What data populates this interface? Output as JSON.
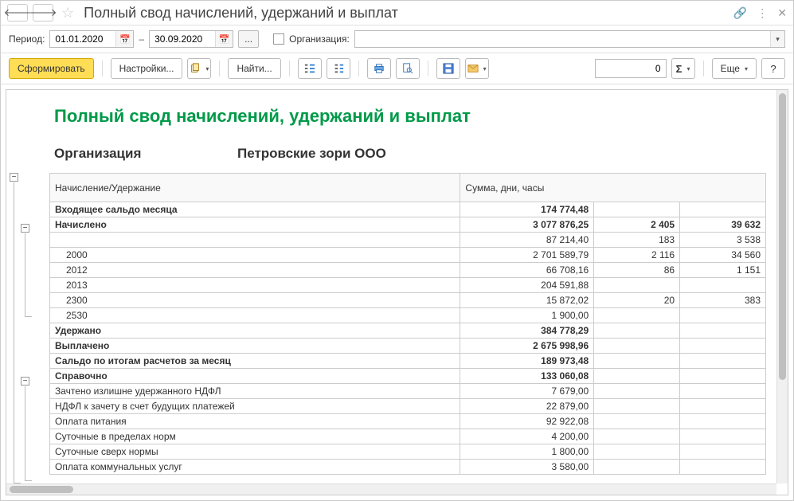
{
  "header": {
    "title": "Полный свод начислений, удержаний и выплат"
  },
  "period": {
    "label": "Период:",
    "from": "01.01.2020",
    "to": "30.09.2020",
    "org_label": "Организация:",
    "org_value": ""
  },
  "toolbar": {
    "generate": "Сформировать",
    "settings": "Настройки...",
    "find": "Найти...",
    "num": "0",
    "more": "Еще"
  },
  "report": {
    "title": "Полный свод начислений, удержаний и выплат",
    "org_label": "Организация",
    "org_value": "Петровские зори ООО",
    "col_name": "Начисление/Удержание",
    "col_sum": "Сумма, дни, часы",
    "rows": [
      {
        "name": "Входящее сальдо месяца",
        "sum": "174 774,48",
        "d": "",
        "h": "",
        "bold": true,
        "indent": 0
      },
      {
        "name": "Начислено",
        "sum": "3 077 876,25",
        "d": "2 405",
        "h": "39 632",
        "bold": true,
        "indent": 0
      },
      {
        "name": "",
        "sum": "87 214,40",
        "d": "183",
        "h": "3 538",
        "bold": false,
        "indent": 1
      },
      {
        "name": "2000",
        "sum": "2 701 589,79",
        "d": "2 116",
        "h": "34 560",
        "bold": false,
        "indent": 1
      },
      {
        "name": "2012",
        "sum": "66 708,16",
        "d": "86",
        "h": "1 151",
        "bold": false,
        "indent": 1
      },
      {
        "name": "2013",
        "sum": "204 591,88",
        "d": "",
        "h": "",
        "bold": false,
        "indent": 1
      },
      {
        "name": "2300",
        "sum": "15 872,02",
        "d": "20",
        "h": "383",
        "bold": false,
        "indent": 1
      },
      {
        "name": "2530",
        "sum": "1 900,00",
        "d": "",
        "h": "",
        "bold": false,
        "indent": 1
      },
      {
        "name": "Удержано",
        "sum": "384 778,29",
        "d": "",
        "h": "",
        "bold": true,
        "indent": 0
      },
      {
        "name": "Выплачено",
        "sum": "2 675 998,96",
        "d": "",
        "h": "",
        "bold": true,
        "indent": 0
      },
      {
        "name": "Сальдо по итогам расчетов за месяц",
        "sum": "189 973,48",
        "d": "",
        "h": "",
        "bold": true,
        "indent": 0
      },
      {
        "name": "Справочно",
        "sum": "133 060,08",
        "d": "",
        "h": "",
        "bold": true,
        "indent": 0
      },
      {
        "name": "Зачтено излишне удержанного НДФЛ",
        "sum": "7 679,00",
        "d": "",
        "h": "",
        "bold": false,
        "indent": 0
      },
      {
        "name": "НДФЛ к зачету в счет будущих платежей",
        "sum": "22 879,00",
        "d": "",
        "h": "",
        "bold": false,
        "indent": 0
      },
      {
        "name": "Оплата питания",
        "sum": "92 922,08",
        "d": "",
        "h": "",
        "bold": false,
        "indent": 0
      },
      {
        "name": "Суточные в пределах норм",
        "sum": "4 200,00",
        "d": "",
        "h": "",
        "bold": false,
        "indent": 0
      },
      {
        "name": "Суточные сверх нормы",
        "sum": "1 800,00",
        "d": "",
        "h": "",
        "bold": false,
        "indent": 0
      },
      {
        "name": "Оплата коммунальных услуг",
        "sum": "3 580,00",
        "d": "",
        "h": "",
        "bold": false,
        "indent": 0
      }
    ]
  }
}
